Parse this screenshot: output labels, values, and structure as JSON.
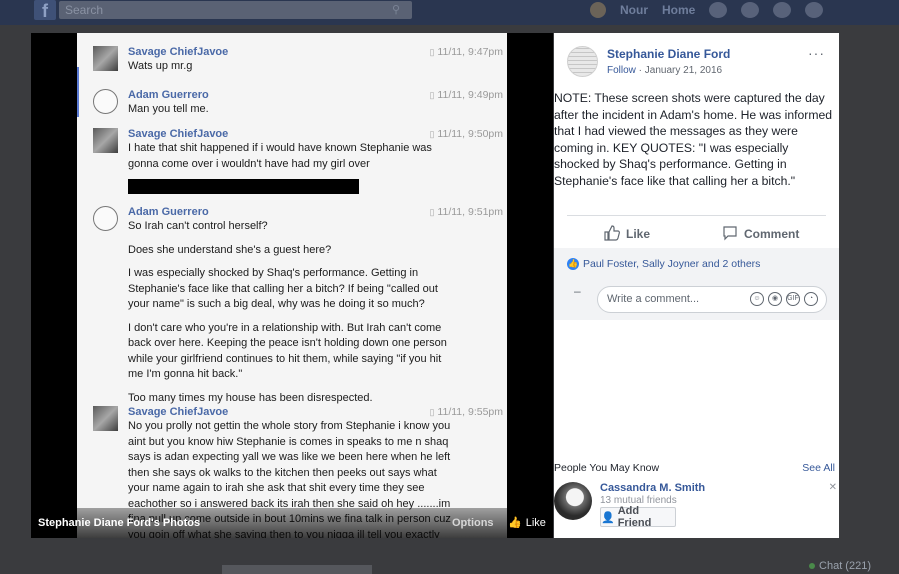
{
  "topbar": {
    "logo": "f",
    "search_placeholder": "Search",
    "nav_user": "Nour",
    "nav_home": "Home"
  },
  "chat": {
    "label": "Chat (221)"
  },
  "viewer": {
    "caption_title": "Stephanie Diane Ford's Photos",
    "options_label": "Options",
    "like_label": "Like"
  },
  "photo": {
    "messages": [
      {
        "name": "Savage ChiefJavoe",
        "time": "11/11, 9:47pm",
        "lines": [
          "Wats up mr.g"
        ]
      },
      {
        "name": "Adam Guerrero",
        "time": "11/11, 9:49pm",
        "lines": [
          "Man you tell me."
        ]
      },
      {
        "name": "Savage ChiefJavoe",
        "time": "11/11, 9:50pm",
        "lines": [
          "I hate that shit happened if i would have known Stephanie was gonna come over i wouldn't have had my girl over"
        ]
      },
      {
        "name": "Adam Guerrero",
        "time": "11/11, 9:51pm",
        "lines": [
          "So Irah can't control herself?",
          "Does she understand she's a guest here?",
          "I was especially shocked by Shaq's performance. Getting in Stephanie's face like that calling her a bitch? If being \"called out your name\" is such a big deal, why was he doing it so much?",
          "I don't care who you're in a relationship with. But Irah can't come back over here. Keeping the peace isn't holding down one person while your girlfriend continues to hit them, while saying \"if you hit me I'm gonna hit back.\"",
          "Too many times my house has been disrespected."
        ]
      },
      {
        "name": "Savage ChiefJavoe",
        "time": "11/11, 9:55pm",
        "lines": [
          "No you prolly not gettin the whole story from Stephanie i know you aint but you know hiw Stephanie is comes in speaks to me n shaq says is adan expecting yall we was like we been here when he left then she says ok walks to the kitchen then peeks out says what your name again to irah she ask that shit every time they see eachother so i answered back its irah then she said oh hey .......im fina pull up come outside in bout 10mins we fina talk in person cuz you goin off what she saying then to you nigga ill tell you exactly what happened"
        ]
      }
    ]
  },
  "post": {
    "author": "Stephanie Diane Ford",
    "follow": "Follow",
    "date": "January 21, 2016",
    "more": "···",
    "text": "NOTE: These screen shots were captured the day after the incident in Adam's home. He was informed that I had viewed the messages as they were coming in. KEY QUOTES: \"I was especially shocked by Shaq's performance. Getting in Stephanie's face like that calling her a bitch.\"",
    "like_label": "Like",
    "comment_label": "Comment",
    "reactions_text": "Paul Foster, Sally Joyner and 2 others",
    "comment_placeholder": "Write a comment...",
    "comment_icon_gif": "GIF"
  },
  "pymk": {
    "title": "People You May Know",
    "see_all": "See All",
    "person": {
      "name": "Cassandra M. Smith",
      "mutual": "13 mutual friends",
      "add_label": "Add Friend"
    }
  }
}
